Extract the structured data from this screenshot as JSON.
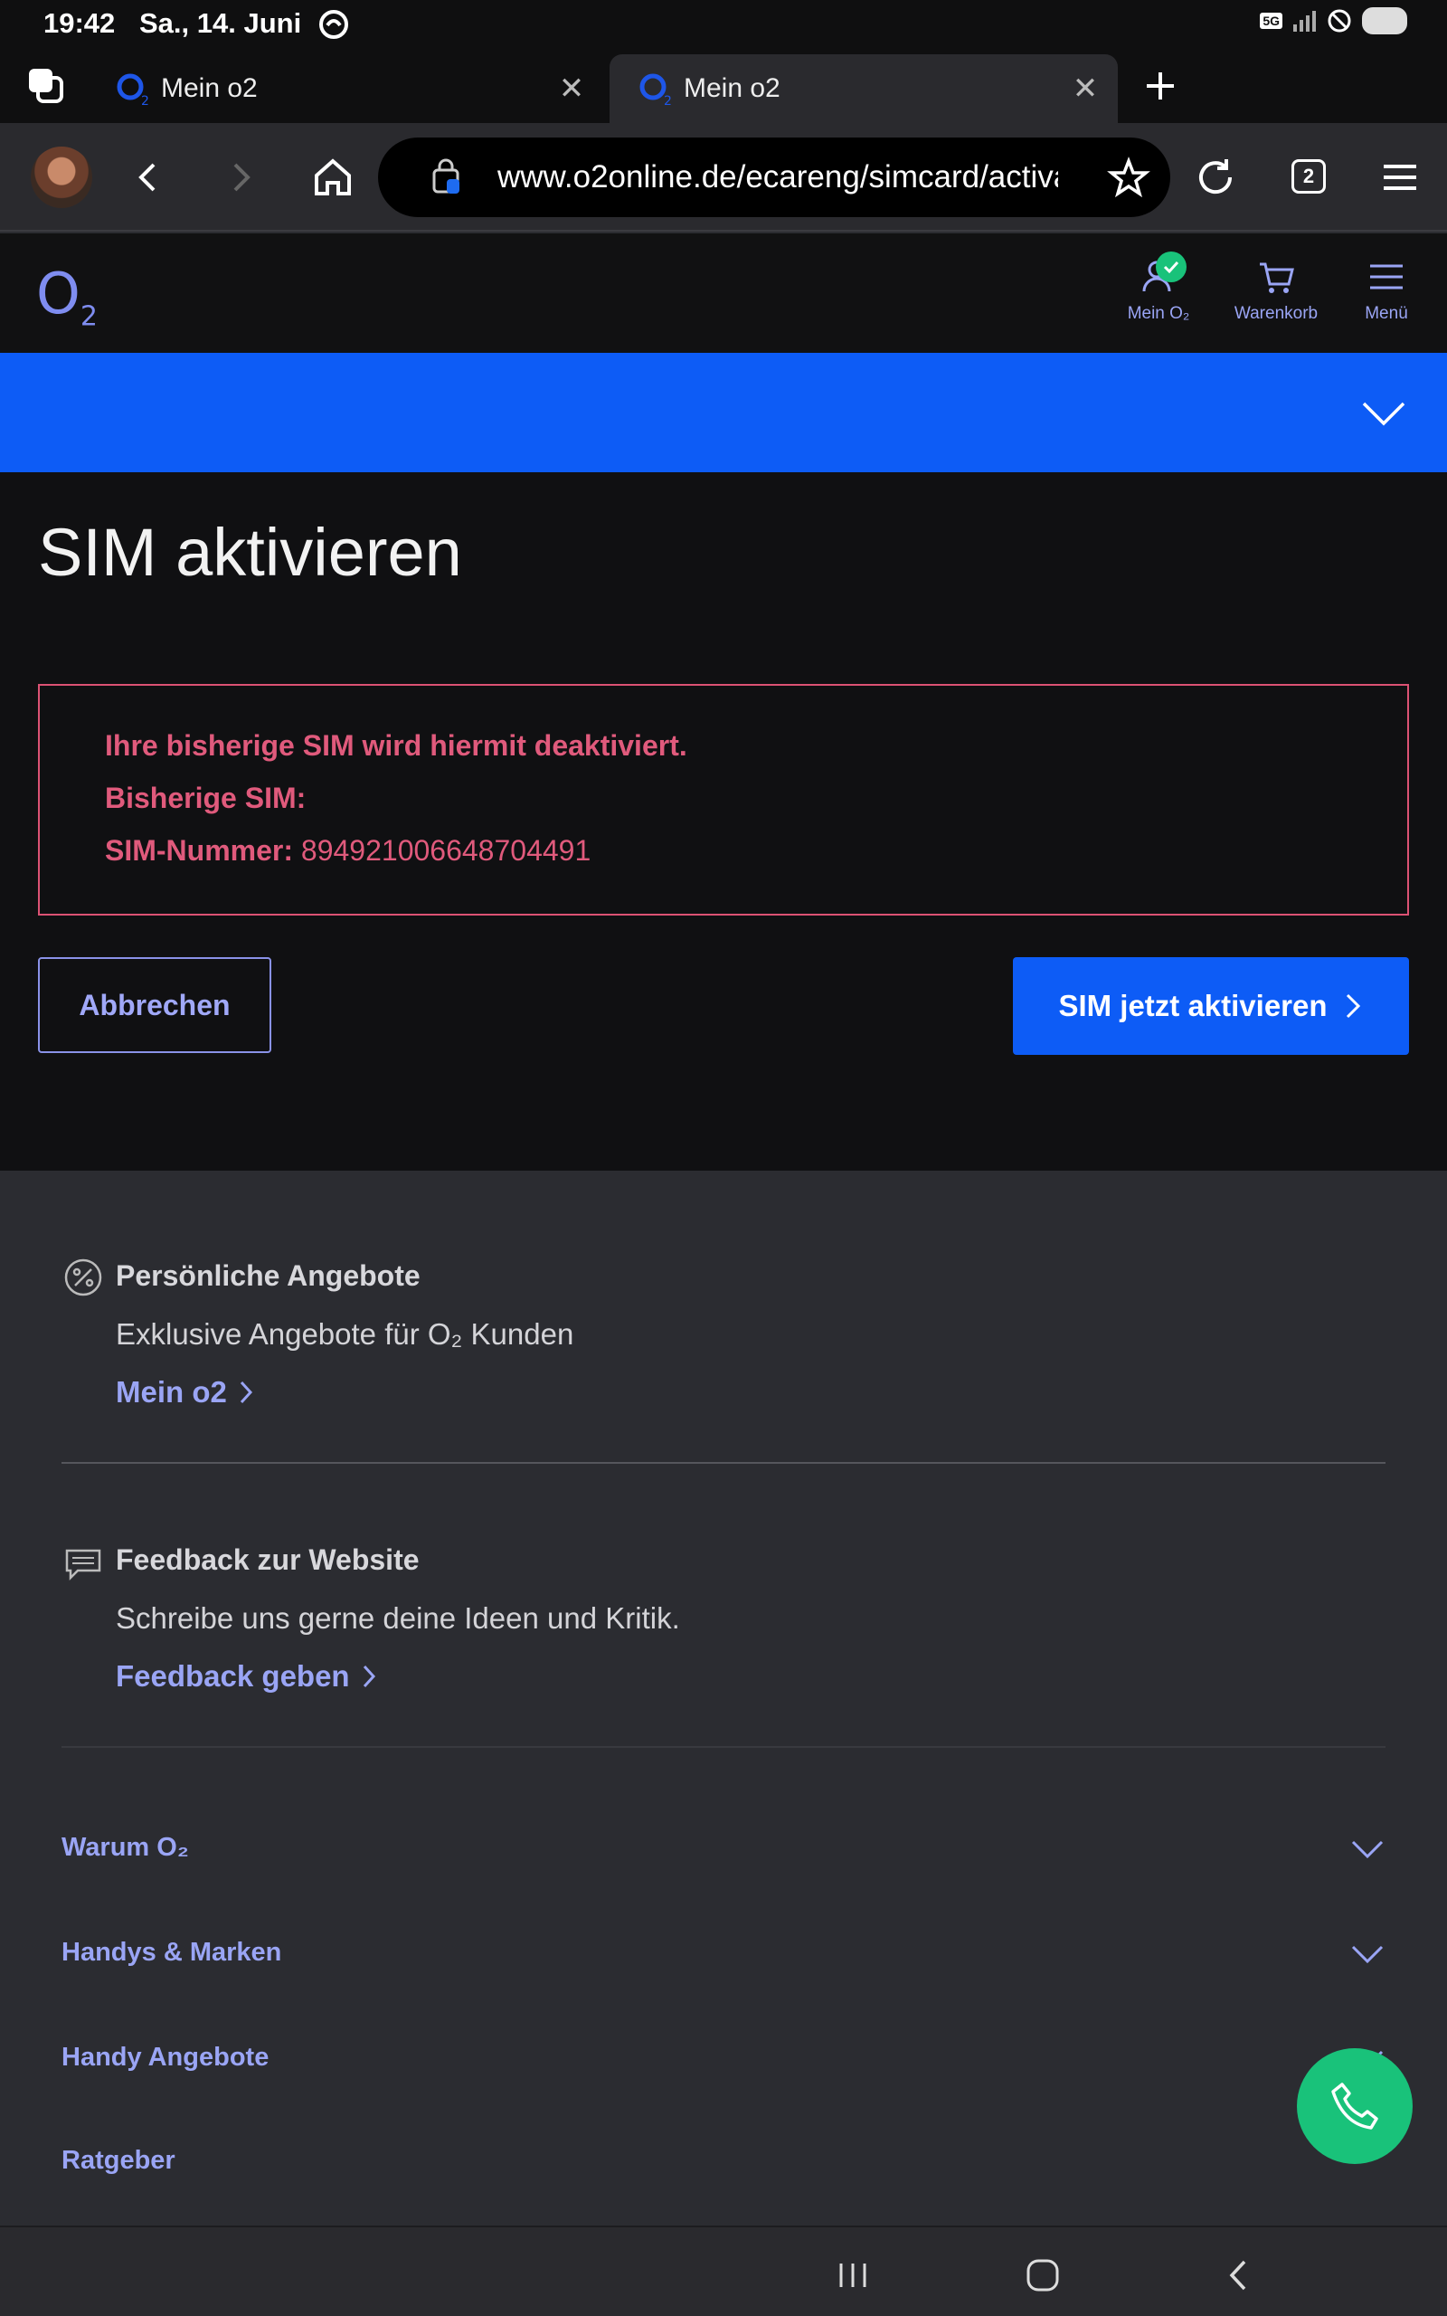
{
  "status_bar": {
    "time": "19:42",
    "date": "Sa., 14. Juni",
    "network": "5G"
  },
  "browser": {
    "tabs": [
      {
        "title": "Mein o2",
        "active": false
      },
      {
        "title": "Mein o2",
        "active": true
      }
    ],
    "url": "www.o2online.de/ecareng/simcard/activa",
    "tab_count": "2"
  },
  "site_header": {
    "logo": "O",
    "logo_sub": "2",
    "nav": [
      {
        "label": "Mein O₂",
        "icon": "user-icon"
      },
      {
        "label": "Warenkorb",
        "icon": "cart-icon"
      },
      {
        "label": "Menü",
        "icon": "hamburger-icon"
      }
    ]
  },
  "main": {
    "title": "SIM aktivieren",
    "warning": {
      "line1": "Ihre bisherige SIM wird hiermit deaktiviert.",
      "line2": "Bisherige SIM:",
      "sim_label": "SIM-Nummer:",
      "sim_number": "894921006648704491"
    },
    "cancel_label": "Abbrechen",
    "activate_label": "SIM jetzt aktivieren"
  },
  "footer": {
    "offers": {
      "title": "Persönliche Angebote",
      "text": "Exklusive Angebote für O₂ Kunden",
      "link": "Mein o2"
    },
    "feedback": {
      "title": "Feedback zur Website",
      "text": "Schreibe uns gerne deine Ideen und Kritik.",
      "link": "Feedback geben"
    },
    "accordion": [
      "Warum O₂",
      "Handys & Marken",
      "Handy Angebote",
      "Ratgeber"
    ]
  },
  "colors": {
    "brand_blue": "#0d5cf6",
    "link": "#9aa5f5",
    "warning": "#e05a7c",
    "fab": "#19c27a"
  }
}
